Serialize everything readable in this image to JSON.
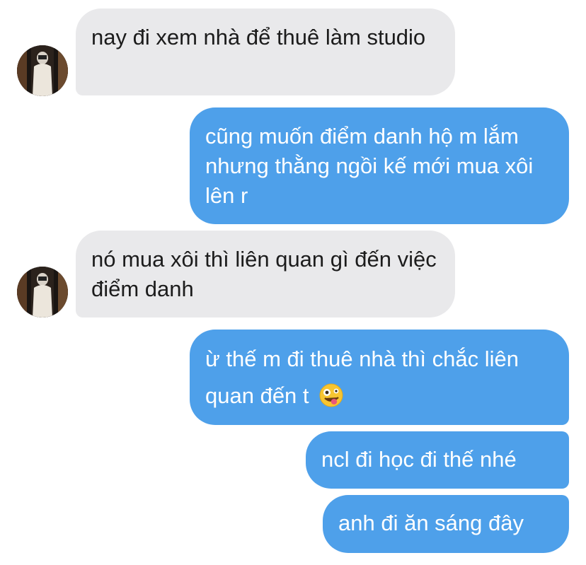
{
  "conversation": {
    "messages": [
      {
        "sender": "them",
        "text": "nay đi xem nhà để thuê làm studio"
      },
      {
        "sender": "me",
        "text": "cũng muốn điểm danh hộ m lắm nhưng thằng ngồi kế mới mua xôi lên r"
      },
      {
        "sender": "them",
        "text": "nó mua xôi thì liên quan gì đến việc điểm danh"
      },
      {
        "sender": "me",
        "text": "ừ thế m đi thuê nhà thì chắc liên quan đến t",
        "emoji": "zany-face-emoji"
      },
      {
        "sender": "me",
        "text": "ncl đi học đi thế nhé"
      },
      {
        "sender": "me",
        "text": "anh đi ăn sáng đây"
      }
    ]
  },
  "colors": {
    "incoming_bubble": "#e9e9eb",
    "outgoing_bubble": "#4ea0ea",
    "incoming_text": "#1c1c1c",
    "outgoing_text": "#ffffff"
  }
}
